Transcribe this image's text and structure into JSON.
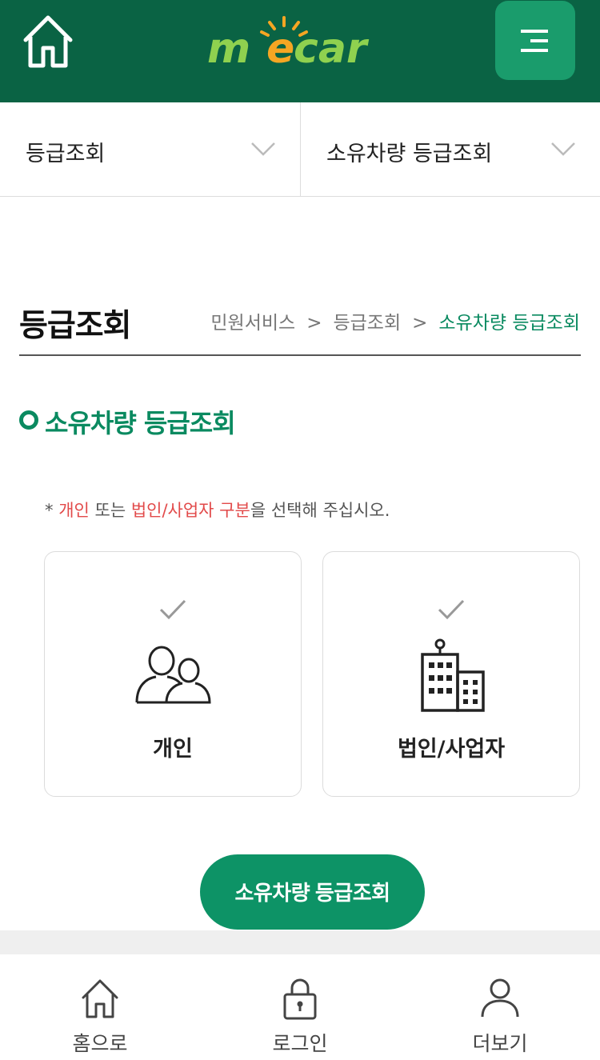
{
  "header": {
    "logo_text": "mecar"
  },
  "selectors": [
    {
      "label": "등급조회"
    },
    {
      "label": "소유차량 등급조회"
    }
  ],
  "page": {
    "title": "등급조회",
    "breadcrumb": [
      "민원서비스",
      "등급조회",
      "소유차량 등급조회"
    ],
    "breadcrumb_sep": ">"
  },
  "section": {
    "title": "소유차량 등급조회"
  },
  "notice": {
    "prefix": "* ",
    "highlight1": "개인",
    "mid": " 또는 ",
    "highlight2": "법인/사업자 구분",
    "suffix": "을 선택해 주십시오."
  },
  "options": [
    {
      "label": "개인",
      "icon": "people-icon",
      "checked": false
    },
    {
      "label": "법인/사업자",
      "icon": "building-icon",
      "checked": false
    }
  ],
  "submit_label": "소유차량 등급조회",
  "bottom_nav": [
    {
      "label": "홈으로",
      "icon": "home-icon"
    },
    {
      "label": "로그인",
      "icon": "lock-icon"
    },
    {
      "label": "더보기",
      "icon": "user-icon"
    }
  ],
  "colors": {
    "header_bg": "#0a6344",
    "menu_bg": "#1a9c6c",
    "accent": "#0a8a60",
    "highlight": "#e24a4a",
    "button": "#0d9366"
  }
}
